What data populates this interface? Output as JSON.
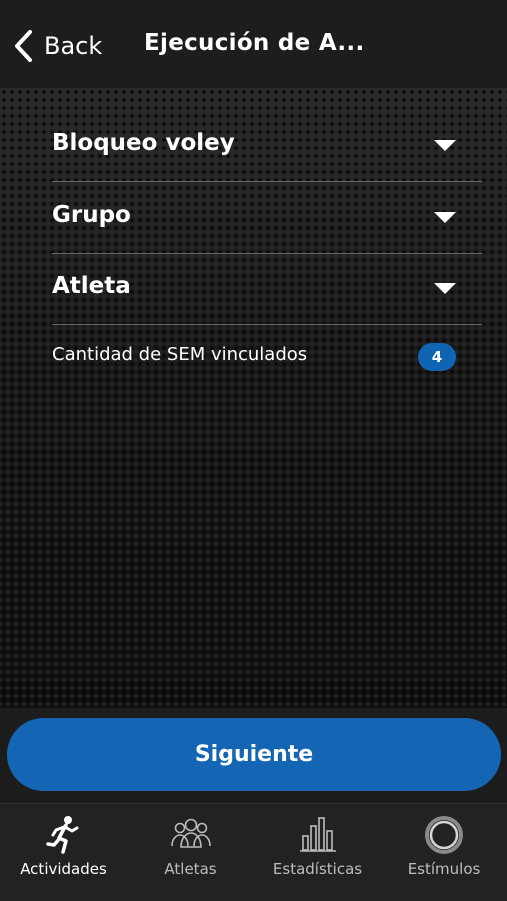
{
  "nav": {
    "back_label": "Back",
    "title": "Ejecución de A..."
  },
  "form": {
    "rows": [
      {
        "label": "Bloqueo voley",
        "icon": "caret-down-icon"
      },
      {
        "label": "Grupo",
        "icon": "caret-down-icon"
      },
      {
        "label": "Atleta",
        "icon": "caret-down-icon"
      }
    ],
    "linked_sem": {
      "label": "Cantidad de SEM vinculados",
      "count": "4"
    }
  },
  "next_button": {
    "label": "Siguiente"
  },
  "tabbar": {
    "tabs": [
      {
        "label": "Actividades",
        "icon": "runner-icon",
        "active": true
      },
      {
        "label": "Atletas",
        "icon": "people-group-icon",
        "active": false
      },
      {
        "label": "Estadísticas",
        "icon": "bar-chart-icon",
        "active": false
      },
      {
        "label": "Estímulos",
        "icon": "ring-icon",
        "active": false
      }
    ]
  },
  "colors": {
    "accent": "#1466b5",
    "badge": "#1064b4",
    "nav_background": "#1d1d1d",
    "tabbar_background": "#222222"
  }
}
